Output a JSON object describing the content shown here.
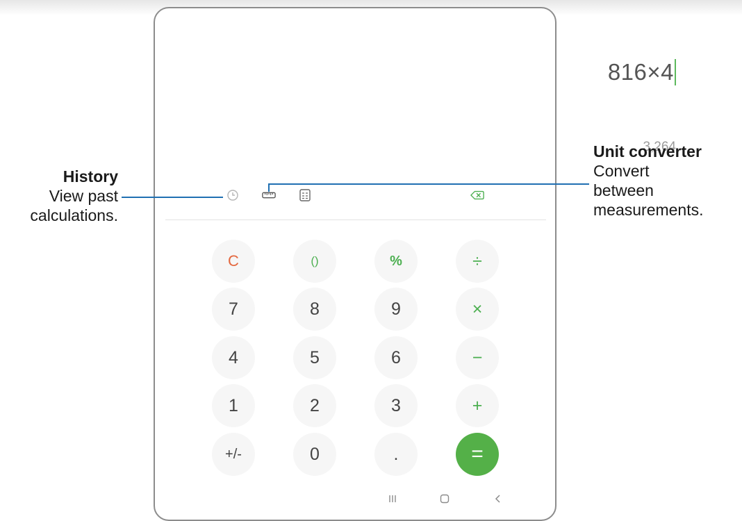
{
  "calculator": {
    "expression": "816×4",
    "result": "3,264",
    "toolbar": {
      "history_icon": "clock-icon",
      "converter_icon": "ruler-icon",
      "scientific_icon": "calculator-grid-icon",
      "backspace_icon": "backspace-icon"
    },
    "keys": [
      [
        "C",
        "()",
        "%",
        "÷"
      ],
      [
        "7",
        "8",
        "9",
        "×"
      ],
      [
        "4",
        "5",
        "6",
        "−"
      ],
      [
        "1",
        "2",
        "3",
        "+"
      ],
      [
        "+/-",
        "0",
        ".",
        "="
      ]
    ],
    "navigation": {
      "recents_icon": "recents-icon",
      "home_icon": "home-icon",
      "back_icon": "back-icon"
    }
  },
  "callouts": {
    "history": {
      "title": "History",
      "line1": "View past",
      "line2": "calculations."
    },
    "unit_converter": {
      "title": "Unit converter",
      "line1": "Convert",
      "line2": "between",
      "line3": "measurements."
    }
  },
  "colors": {
    "accent_green": "#54b048",
    "clear_red": "#e4683f",
    "leader_blue": "#1f6fb2"
  }
}
